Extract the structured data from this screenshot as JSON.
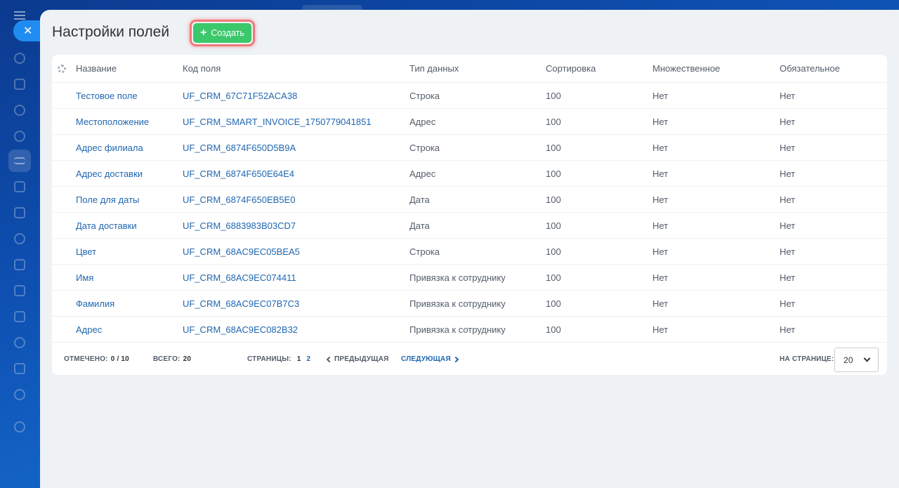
{
  "page": {
    "title": "Настройки полей",
    "create_button": "Создать"
  },
  "columns": {
    "name": "Название",
    "code": "Код поля",
    "type": "Тип данных",
    "sort": "Сортировка",
    "multiple": "Множественное",
    "required": "Обязательное"
  },
  "rows": [
    {
      "name": "Тестовое поле",
      "code": "UF_CRM_67C71F52ACA38",
      "type": "Строка",
      "sort": "100",
      "multiple": "Нет",
      "required": "Нет"
    },
    {
      "name": "Местоположение",
      "code": "UF_CRM_SMART_INVOICE_1750779041851",
      "type": "Адрес",
      "sort": "100",
      "multiple": "Нет",
      "required": "Нет"
    },
    {
      "name": "Адрес филиала",
      "code": "UF_CRM_6874F650D5B9A",
      "type": "Строка",
      "sort": "100",
      "multiple": "Нет",
      "required": "Нет"
    },
    {
      "name": "Адрес доставки",
      "code": "UF_CRM_6874F650E64E4",
      "type": "Адрес",
      "sort": "100",
      "multiple": "Нет",
      "required": "Нет"
    },
    {
      "name": "Поле для даты",
      "code": "UF_CRM_6874F650EB5E0",
      "type": "Дата",
      "sort": "100",
      "multiple": "Нет",
      "required": "Нет"
    },
    {
      "name": "Дата доставки",
      "code": "UF_CRM_6883983B03CD7",
      "type": "Дата",
      "sort": "100",
      "multiple": "Нет",
      "required": "Нет"
    },
    {
      "name": "Цвет",
      "code": "UF_CRM_68AC9EC05BEA5",
      "type": "Строка",
      "sort": "100",
      "multiple": "Нет",
      "required": "Нет"
    },
    {
      "name": "Имя",
      "code": "UF_CRM_68AC9EC074411",
      "type": "Привязка к сотруднику",
      "sort": "100",
      "multiple": "Нет",
      "required": "Нет"
    },
    {
      "name": "Фамилия",
      "code": "UF_CRM_68AC9EC07B7C3",
      "type": "Привязка к сотруднику",
      "sort": "100",
      "multiple": "Нет",
      "required": "Нет"
    },
    {
      "name": "Адрес",
      "code": "UF_CRM_68AC9EC082B32",
      "type": "Привязка к сотруднику",
      "sort": "100",
      "multiple": "Нет",
      "required": "Нет"
    }
  ],
  "footer": {
    "selected_label": "ОТМЕЧЕНО:",
    "selected_value": "0 / 10",
    "total_label": "ВСЕГО:",
    "total_value": "20",
    "pages_label": "СТРАНИЦЫ:",
    "page_current": "1",
    "page_other": "2",
    "prev_label": "ПРЕДЫДУЩАЯ",
    "next_label": "СЛЕДУЮЩАЯ",
    "per_page_label": "НА СТРАНИЦЕ:",
    "per_page_value": "20"
  },
  "colors": {
    "accent_green": "#3bc86b",
    "link_blue": "#2067b0",
    "highlight_red": "#f07a7a"
  }
}
